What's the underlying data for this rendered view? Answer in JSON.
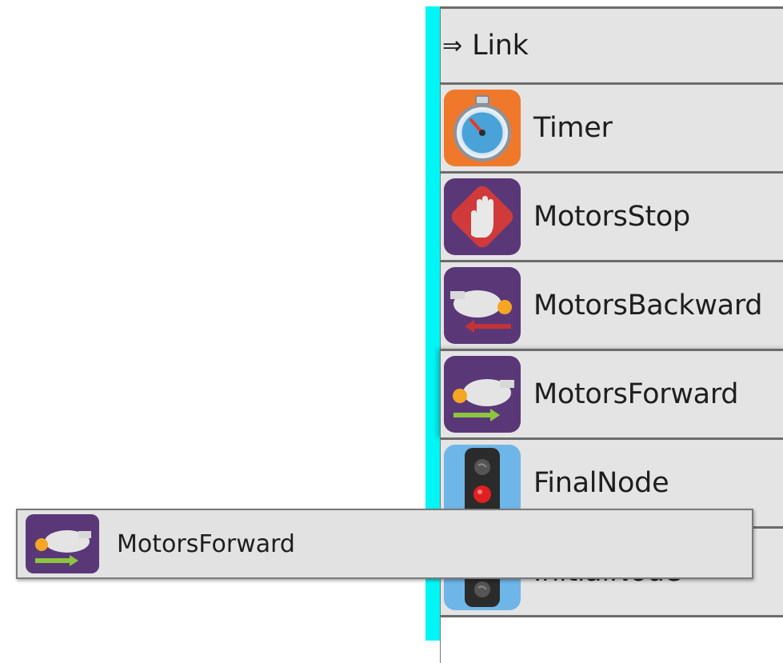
{
  "palette": {
    "link": {
      "label": "Link",
      "icon": "arrow-right-icon"
    },
    "items": [
      {
        "label": "Timer",
        "icon": "stopwatch-icon"
      },
      {
        "label": "MotorsStop",
        "icon": "stop-hand-icon"
      },
      {
        "label": "MotorsBackward",
        "icon": "motors-backward-icon"
      },
      {
        "label": "MotorsForward",
        "icon": "motors-forward-icon"
      },
      {
        "label": "FinalNode",
        "icon": "traffic-light-red-icon"
      },
      {
        "label": "InitialNode",
        "icon": "traffic-light-icon"
      }
    ],
    "accent_color": "#00f5f5"
  },
  "drag_ghost": {
    "label": "MotorsForward",
    "icon": "motors-forward-icon"
  }
}
